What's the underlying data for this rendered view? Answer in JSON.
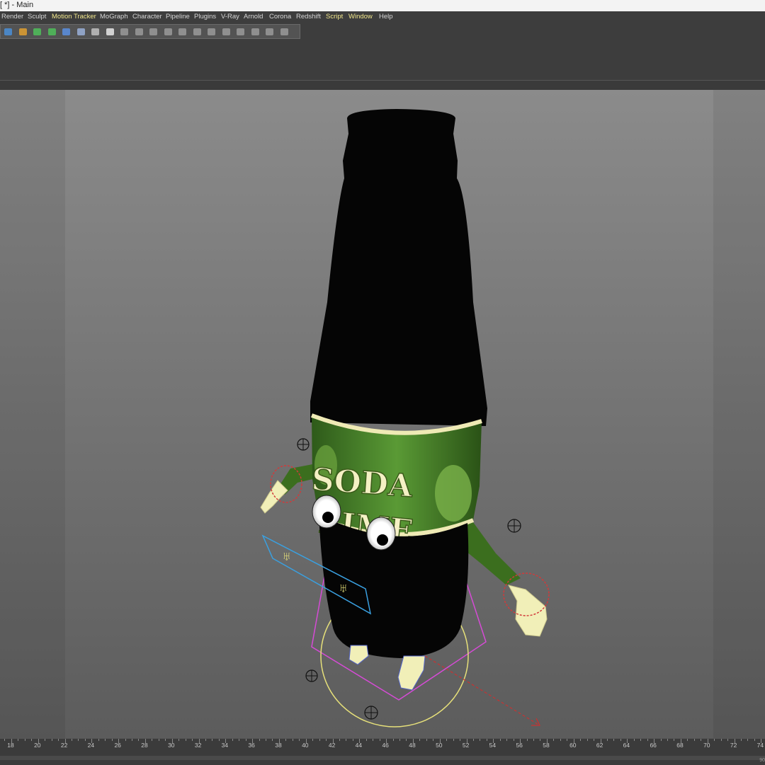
{
  "window": {
    "title": "[ *] - Main"
  },
  "menu": [
    {
      "label": "Render",
      "highlight": false
    },
    {
      "label": "Sculpt",
      "highlight": false
    },
    {
      "label": "Motion Tracker",
      "highlight": true
    },
    {
      "label": "MoGraph",
      "highlight": false
    },
    {
      "label": "Character",
      "highlight": false
    },
    {
      "label": "Pipeline",
      "highlight": false
    },
    {
      "label": "Plugins",
      "highlight": false
    },
    {
      "label": "V-Ray",
      "highlight": false
    },
    {
      "label": "Arnold",
      "highlight": false
    },
    {
      "label": "Corona",
      "highlight": false
    },
    {
      "label": "Redshift",
      "highlight": false
    },
    {
      "label": "Script",
      "highlight": true
    },
    {
      "label": "Window",
      "highlight": true
    },
    {
      "label": "Help",
      "highlight": false
    }
  ],
  "toolbar_icons": [
    "cube-icon",
    "pen-icon",
    "cloner-icon",
    "sphere-gen-icon",
    "deformer-icon",
    "floor-icon",
    "camera-icon",
    "light-icon",
    "grid-icon",
    "spline-icon",
    "polygon-icon",
    "bend-icon",
    "twist-icon",
    "taper-icon",
    "bulge-icon",
    "shear-icon",
    "wrap-icon",
    "array-icon",
    "array2-icon",
    "array3-icon"
  ],
  "label_text": {
    "line1": "SODA",
    "line2": "LIME"
  },
  "ruler": {
    "ticks": [
      "18",
      "20",
      "22",
      "24",
      "26",
      "28",
      "30",
      "32",
      "34",
      "36",
      "38",
      "40",
      "42",
      "44",
      "46",
      "48",
      "50",
      "52",
      "54",
      "56",
      "58",
      "60",
      "62",
      "64",
      "66",
      "68",
      "70",
      "72",
      "74"
    ],
    "frame_value": "90"
  },
  "colors": {
    "menu_text": "#d6d6d6",
    "menu_highlight": "#f0e68c",
    "viewport_top": "#8b8b8b",
    "viewport_bottom": "#5c5c5c",
    "bottle": "#050505",
    "label_green": "#4f8a2a",
    "label_text": "#f4f0c4",
    "arm_green": "#3b6e1e",
    "glove": "#f1efb8",
    "ik_red": "#d23a3a",
    "ik_yellow": "#e6e07a",
    "ik_magenta": "#d64bd6",
    "ik_blue": "#3aa0e0"
  }
}
